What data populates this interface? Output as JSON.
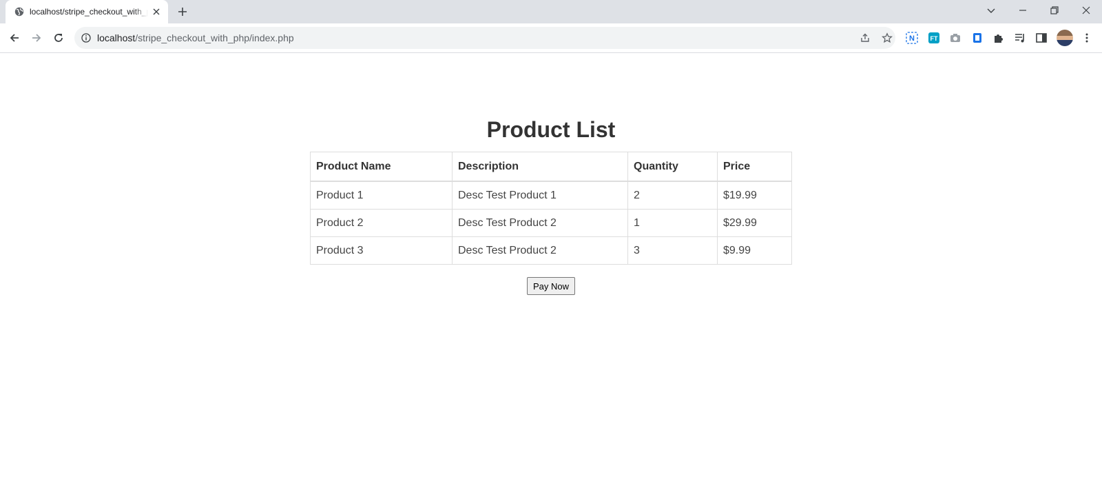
{
  "browser": {
    "tab_title": "localhost/stripe_checkout_with_php/index.php",
    "url_host": "localhost",
    "url_path": "/stripe_checkout_with_php/index.php"
  },
  "page": {
    "title": "Product List",
    "table": {
      "headers": [
        "Product Name",
        "Description",
        "Quantity",
        "Price"
      ],
      "rows": [
        [
          "Product 1",
          "Desc Test Product 1",
          "2",
          "$19.99"
        ],
        [
          "Product 2",
          "Desc Test Product 2",
          "1",
          "$29.99"
        ],
        [
          "Product 3",
          "Desc Test Product 2",
          "3",
          "$9.99"
        ]
      ]
    },
    "pay_button_label": "Pay Now"
  },
  "colors": {
    "tab_strip": "#dee1e6",
    "omnibox": "#f1f3f4",
    "table_border": "#dddddd",
    "ext_blue": "#1a73e8",
    "ext_teal": "#00a0c6"
  },
  "icons": {
    "tab_favicon": "globe-icon",
    "tab_close": "close-icon",
    "new_tab": "plus-icon",
    "window_controls": [
      "tab-search-icon",
      "minimize-icon",
      "restore-icon",
      "window-close-icon"
    ],
    "navigation": [
      "back-arrow-icon",
      "forward-arrow-icon",
      "reload-icon"
    ],
    "omnibox": [
      "info-icon",
      "share-icon",
      "star-icon"
    ],
    "extensions": [
      "n-extension-icon",
      "ft-extension-icon",
      "camera-icon",
      "clipboard-icon",
      "puzzle-icon",
      "media-icon",
      "side-panel-icon"
    ]
  }
}
